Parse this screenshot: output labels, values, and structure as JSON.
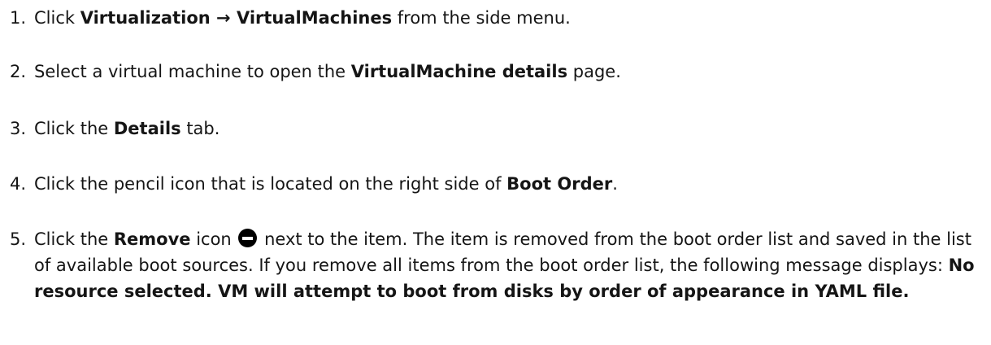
{
  "steps": [
    {
      "number": "1.",
      "parts": [
        "Click ",
        "Virtualization → VirtualMachines",
        " from the side menu."
      ]
    },
    {
      "number": "2.",
      "parts": [
        "Select a virtual machine to open the ",
        "VirtualMachine details",
        " page."
      ]
    },
    {
      "number": "3.",
      "parts": [
        "Click the ",
        "Details",
        " tab."
      ]
    },
    {
      "number": "4.",
      "parts": [
        "Click the pencil icon that is located on the right side of ",
        "Boot Order",
        "."
      ]
    },
    {
      "number": "5.",
      "parts": [
        "Click the ",
        "Remove",
        " icon ",
        " next to the item. The item is removed from the boot order list and saved in the list of available boot sources. If you remove all items from the boot order list, the following message displays: ",
        "No resource selected. VM will attempt to boot from disks by order of appearance in YAML file."
      ]
    }
  ],
  "icons": {
    "remove_icon": "minus-circle-icon"
  }
}
